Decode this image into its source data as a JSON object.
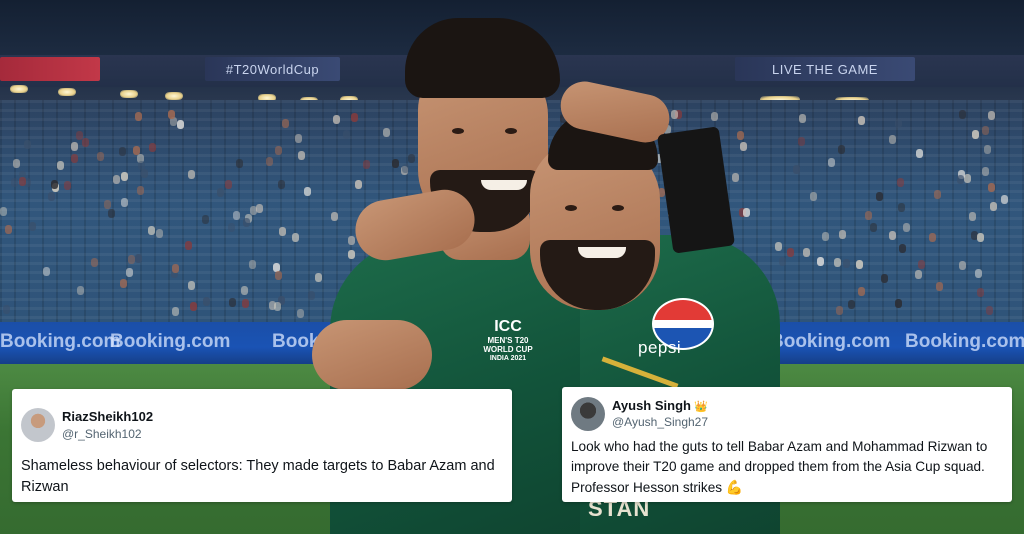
{
  "scene": {
    "stadium_banners": [
      "#T20WorldCup",
      "LIVE THE GAME"
    ],
    "ad_boards": [
      "Booking.com",
      "Booking.com",
      "Booking",
      "Booking.com",
      "Booking.com"
    ],
    "jersey_logo_text": "pepsi",
    "badge_lines": [
      "ICC",
      "MEN'S T20",
      "WORLD CUP",
      "INDIA 2021"
    ],
    "jersey_back_text": "STAN"
  },
  "tweets": [
    {
      "display_name": "RiazSheikh102",
      "handle": "@r_Sheikh102",
      "text": "Shameless behaviour of selectors: They made targets to Babar Azam and Rizwan"
    },
    {
      "display_name": "Ayush Singh",
      "handle": "@Ayush_Singh27",
      "text": "Look who had the guts to tell Babar Azam and Mohammad Rizwan to improve their T20 game and dropped them from the Asia Cup squad. Professor Hesson strikes",
      "trailing_emoji": "💪",
      "name_emoji": "👑"
    }
  ],
  "colors": {
    "jersey_green": "#12533a",
    "pepsi_red": "#e23a36",
    "pepsi_blue": "#1c55b3",
    "adboard_blue": "#1a53b4",
    "tweet_bg": "#ffffff",
    "handle_gray": "#536471"
  }
}
